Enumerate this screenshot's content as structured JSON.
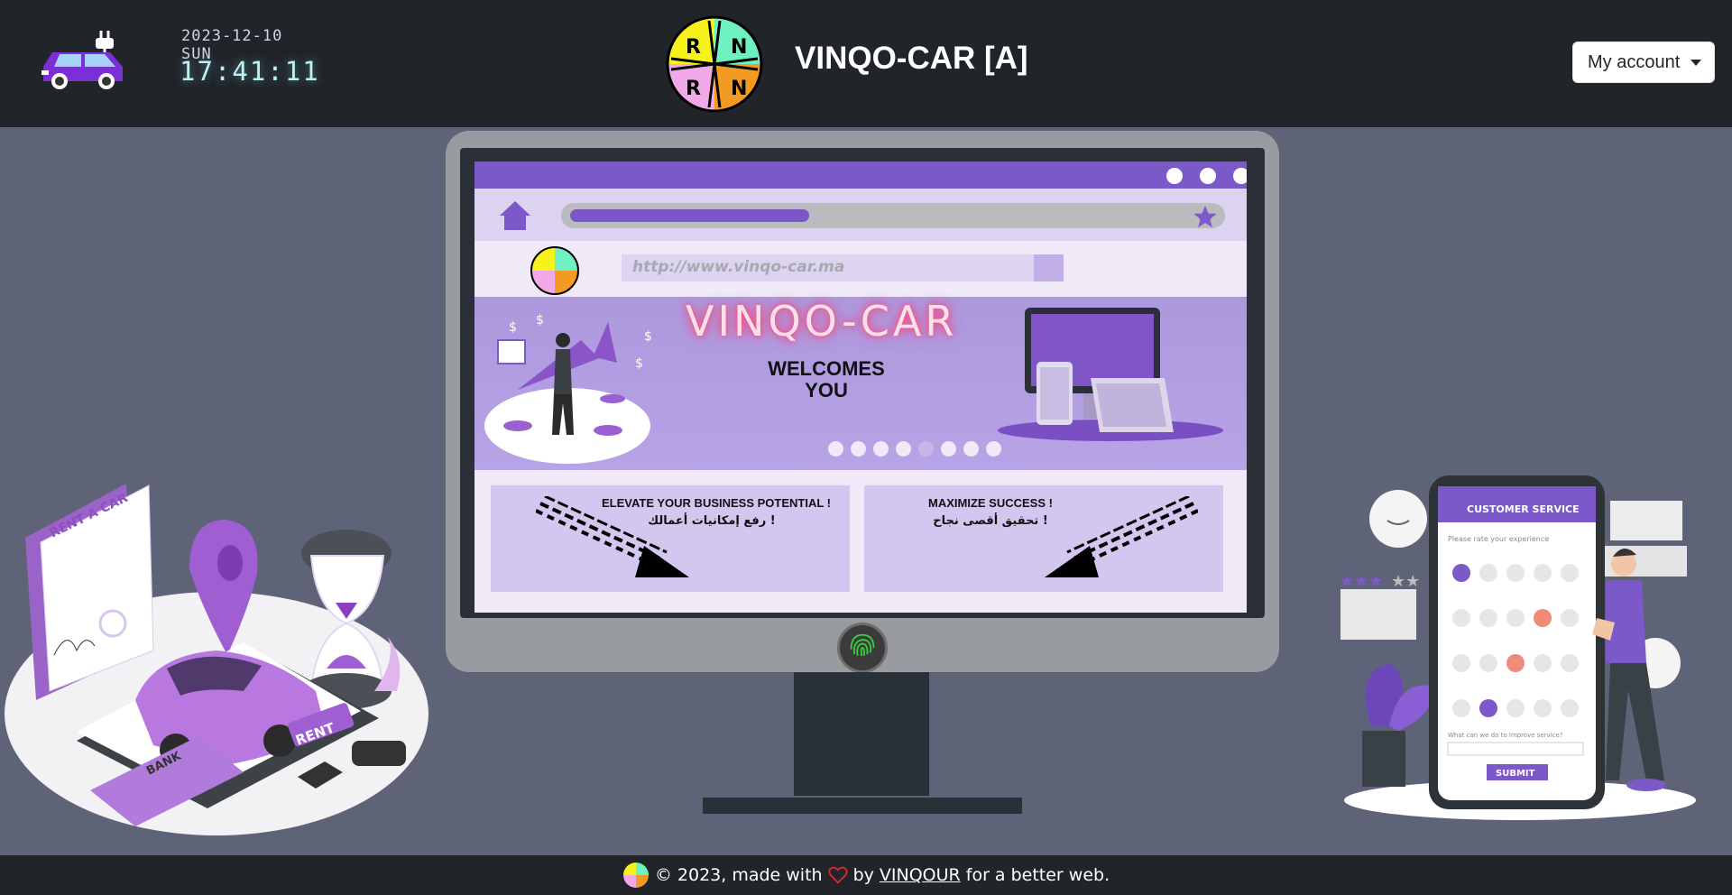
{
  "header": {
    "date": "2023-12-10 SUN",
    "time": "17:41:11",
    "title": "VINQO-CAR [A]",
    "account_label": "My account"
  },
  "screen": {
    "url": "http://www.vinqo-car.ma",
    "hero_title": "VINQO-CAR",
    "hero_subtitle_line1": "WELCOMES",
    "hero_subtitle_line2": "YOU",
    "progress": 0.36,
    "carousel_count": 8,
    "carousel_active": 4,
    "card1_en": "ELEVATE YOUR BUSINESS POTENTIAL !",
    "card1_ar": "رفع إمكانيات أعمالك !",
    "card2_en": "MAXIMIZE SUCCESS !",
    "card2_ar": "تحقيق أقصى نجاح !"
  },
  "illustrations": {
    "left_doc": "RENT A CAR",
    "left_rent": "RENT",
    "left_bank": "BANK",
    "phone_title": "CUSTOMER SERVICE",
    "phone_prompt": "Please rate your experience",
    "phone_question": "What can we do to improve service?",
    "phone_submit": "SUBMIT"
  },
  "footer": {
    "copyright": "© 2023, made with",
    "by": "by",
    "author": "VINQOUR",
    "tagline": "for a better web."
  },
  "colors": {
    "header_bg": "#212529",
    "main_bg": "#5f6378",
    "accent_purple": "#7b59c8",
    "clock_glow": "#bff1f1",
    "heart": "#e0242b"
  },
  "icons": [
    "car-plug-icon",
    "brand-logo",
    "caret-down-icon",
    "home-icon",
    "star-icon",
    "fingerprint-icon",
    "heart-icon"
  ]
}
